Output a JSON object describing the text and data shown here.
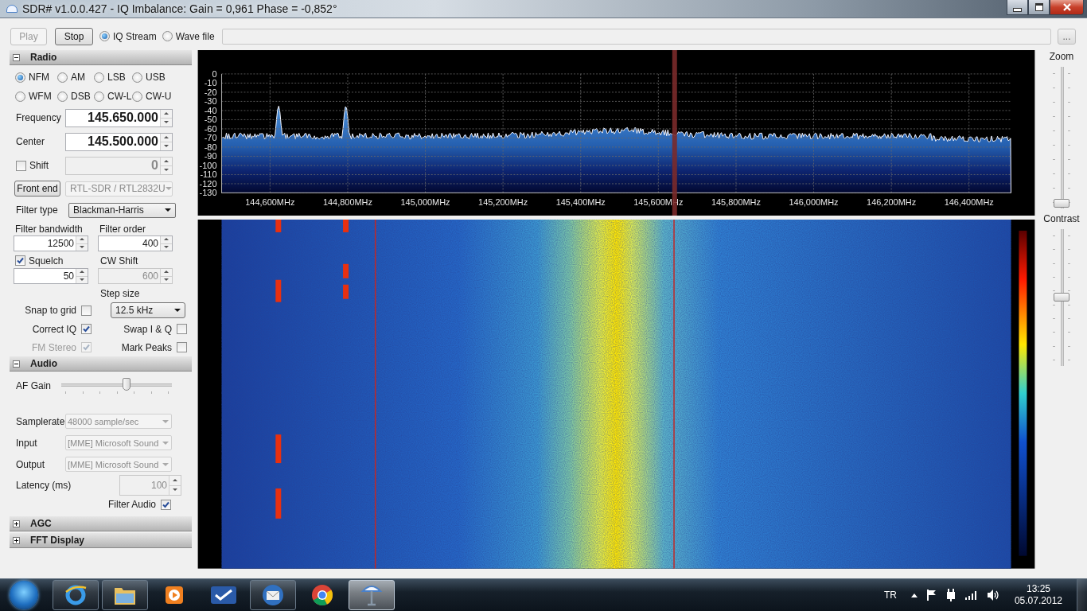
{
  "window": {
    "title": "SDR# v1.0.0.427 - IQ Imbalance: Gain = 0,961 Phase = -0,852°"
  },
  "toolbar": {
    "play": {
      "label": "Play",
      "disabled": true
    },
    "stop": {
      "label": "Stop",
      "disabled": false
    },
    "sources": [
      {
        "label": "IQ Stream",
        "selected": true
      },
      {
        "label": "Wave file",
        "selected": false
      }
    ],
    "browse_button": "..."
  },
  "radio": {
    "title": "Radio",
    "expanded": true,
    "modes": [
      {
        "label": "NFM",
        "selected": true
      },
      {
        "label": "AM",
        "selected": false
      },
      {
        "label": "LSB",
        "selected": false
      },
      {
        "label": "USB",
        "selected": false
      },
      {
        "label": "WFM",
        "selected": false
      },
      {
        "label": "DSB",
        "selected": false
      },
      {
        "label": "CW-L",
        "selected": false
      },
      {
        "label": "CW-U",
        "selected": false
      }
    ],
    "frequency": {
      "label": "Frequency",
      "value": "145.650.000"
    },
    "center": {
      "label": "Center",
      "value": "145.500.000"
    },
    "shift": {
      "label": "Shift",
      "checked": false,
      "value": "0"
    },
    "front_end": {
      "button": "Front end",
      "device": "RTL-SDR / RTL2832U",
      "disabled": true
    },
    "filter_type": {
      "label": "Filter type",
      "value": "Blackman-Harris"
    },
    "filter_bandwidth": {
      "label": "Filter bandwidth",
      "value": "12500",
      "disabled": false
    },
    "filter_order": {
      "label": "Filter order",
      "value": "400",
      "disabled": false
    },
    "squelch": {
      "label": "Squelch",
      "checked": true,
      "value": "50",
      "disabled": false
    },
    "cw_shift": {
      "label": "CW Shift",
      "value": "600",
      "disabled": true
    },
    "step_size": {
      "label": "Step size",
      "value": "12.5 kHz"
    },
    "snap_to_grid": {
      "label": "Snap to grid",
      "checked": false,
      "disabled": false
    },
    "correct_iq": {
      "label": "Correct IQ",
      "checked": true,
      "disabled": false
    },
    "swap_iq": {
      "label": "Swap I & Q",
      "checked": false,
      "disabled": false
    },
    "fm_stereo": {
      "label": "FM Stereo",
      "checked": true,
      "disabled": true
    },
    "mark_peaks": {
      "label": "Mark Peaks",
      "checked": false,
      "disabled": false
    }
  },
  "audio": {
    "title": "Audio",
    "expanded": true,
    "af_gain": {
      "label": "AF Gain",
      "level": 0.6
    },
    "samplerate": {
      "label": "Samplerate",
      "value": "48000 sample/sec",
      "disabled": true
    },
    "input": {
      "label": "Input",
      "value": "[MME] Microsoft Sound",
      "disabled": true
    },
    "output": {
      "label": "Output",
      "value": "[MME] Microsoft Sound",
      "disabled": true
    },
    "latency": {
      "label": "Latency (ms)",
      "value": "100",
      "disabled": true
    },
    "filter_audio": {
      "label": "Filter Audio",
      "checked": true,
      "disabled": false
    }
  },
  "agc": {
    "title": "AGC",
    "expanded": false
  },
  "fft_display": {
    "title": "FFT Display",
    "expanded": false
  },
  "spectrum": {
    "y_labels": [
      "0",
      "-10",
      "-20",
      "-30",
      "-40",
      "-50",
      "-60",
      "-70",
      "-80",
      "-90",
      "-100",
      "-110",
      "-120",
      "-130"
    ],
    "x_labels": [
      "144,600MHz",
      "144,800MHz",
      "145,000MHz",
      "145,200MHz",
      "145,400MHz",
      "145,600MHz",
      "145,800MHz",
      "146,000MHz",
      "146,200MHz",
      "146,400MHz"
    ]
  },
  "display_controls": {
    "zoom": {
      "label": "Zoom",
      "level": 0
    },
    "contrast": {
      "label": "Contrast",
      "level": 0.5
    }
  },
  "taskbar": {
    "apps": [
      {
        "kind": "browser",
        "running": true,
        "selected": false
      },
      {
        "kind": "folder",
        "running": true,
        "selected": false
      },
      {
        "kind": "player",
        "running": false,
        "selected": false
      },
      {
        "kind": "check",
        "running": false,
        "selected": false
      },
      {
        "kind": "mail",
        "running": true,
        "selected": false
      },
      {
        "kind": "chrome",
        "running": false,
        "selected": false
      },
      {
        "kind": "dish",
        "running": true,
        "selected": true
      }
    ],
    "language": "TR",
    "time": "13:25",
    "date": "05.07.2012"
  }
}
